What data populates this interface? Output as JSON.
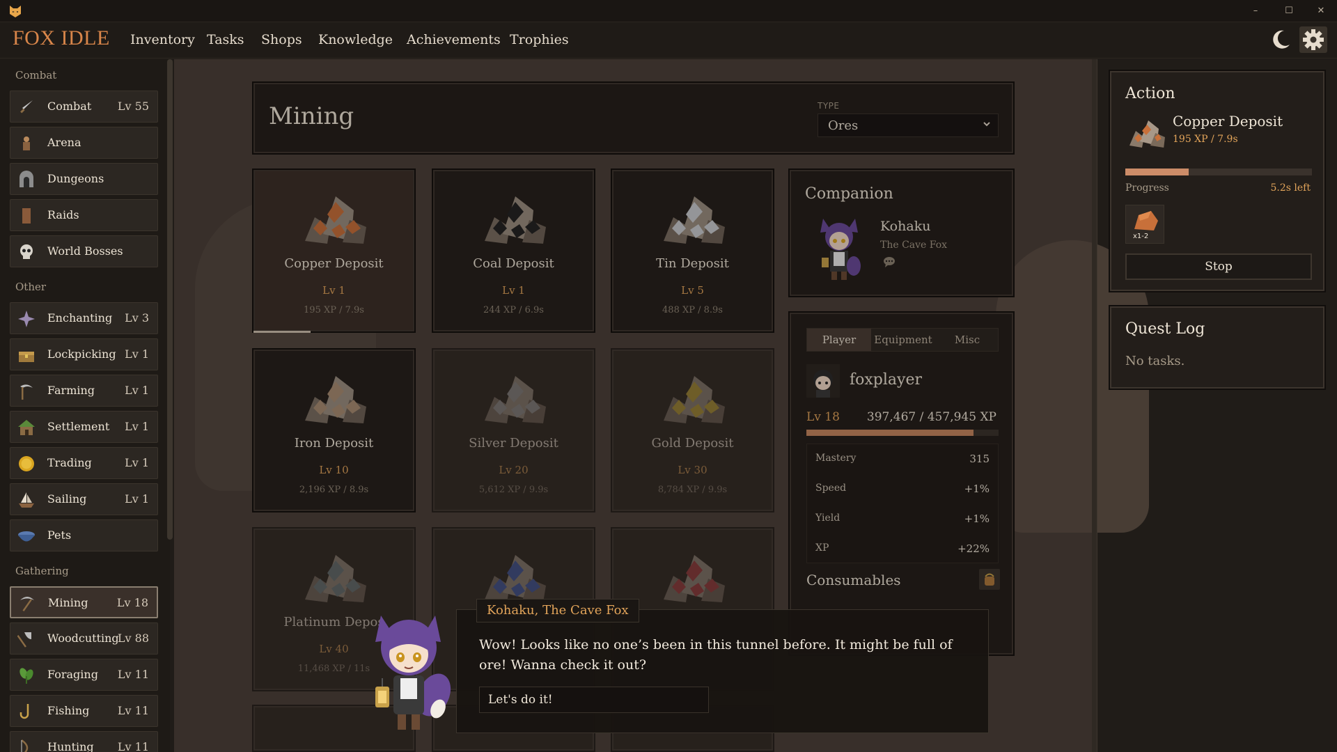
{
  "app": {
    "title": "FOX IDLE"
  },
  "nav": [
    "Inventory",
    "Tasks",
    "Shops",
    "Knowledge",
    "Achievements",
    "Trophies"
  ],
  "sidebar": {
    "sections": [
      {
        "title": "Combat",
        "items": [
          {
            "label": "Combat",
            "level": "Lv 55",
            "icon": "sword-icon"
          },
          {
            "label": "Arena",
            "level": "",
            "icon": "arena-icon"
          },
          {
            "label": "Dungeons",
            "level": "",
            "icon": "dungeon-icon"
          },
          {
            "label": "Raids",
            "level": "",
            "icon": "raid-banner-icon"
          },
          {
            "label": "World Bosses",
            "level": "",
            "icon": "skull-icon"
          }
        ]
      },
      {
        "title": "Other",
        "items": [
          {
            "label": "Enchanting",
            "level": "Lv 3",
            "icon": "enchant-icon"
          },
          {
            "label": "Lockpicking",
            "level": "Lv 1",
            "icon": "chest-icon"
          },
          {
            "label": "Farming",
            "level": "Lv 1",
            "icon": "scythe-icon"
          },
          {
            "label": "Settlement",
            "level": "Lv 1",
            "icon": "house-icon"
          },
          {
            "label": "Trading",
            "level": "Lv 1",
            "icon": "coin-icon"
          },
          {
            "label": "Sailing",
            "level": "Lv 1",
            "icon": "ship-icon"
          },
          {
            "label": "Pets",
            "level": "",
            "icon": "pet-bowl-icon"
          }
        ]
      },
      {
        "title": "Gathering",
        "items": [
          {
            "label": "Mining",
            "level": "Lv 18",
            "icon": "pickaxe-icon",
            "active": true
          },
          {
            "label": "Woodcutting",
            "level": "Lv 88",
            "icon": "axe-icon"
          },
          {
            "label": "Foraging",
            "level": "Lv 11",
            "icon": "herb-icon"
          },
          {
            "label": "Fishing",
            "level": "Lv 11",
            "icon": "hook-icon"
          },
          {
            "label": "Hunting",
            "level": "Lv 11",
            "icon": "bow-icon"
          }
        ]
      }
    ]
  },
  "mining": {
    "title": "Mining",
    "type_label": "TYPE",
    "type_value": "Ores",
    "tiles": [
      {
        "name": "Copper Deposit",
        "level": "Lv 1",
        "xp": "195 XP / 7.9s",
        "color": "#c8703a",
        "selected": true
      },
      {
        "name": "Coal Deposit",
        "level": "Lv 1",
        "xp": "244 XP / 6.9s",
        "color": "#222222"
      },
      {
        "name": "Tin Deposit",
        "level": "Lv 5",
        "xp": "488 XP / 8.9s",
        "color": "#c9ccd0"
      },
      {
        "name": "Iron Deposit",
        "level": "Lv 10",
        "xp": "2,196 XP / 8.9s",
        "color": "#a88d72"
      },
      {
        "name": "Silver Deposit",
        "level": "Lv 20",
        "xp": "5,612 XP / 9.9s",
        "color": "#9a9a9a",
        "dim": true
      },
      {
        "name": "Gold Deposit",
        "level": "Lv 30",
        "xp": "8,784 XP / 9.9s",
        "color": "#c4a534",
        "dim": true
      },
      {
        "name": "Platinum Depos",
        "level": "Lv 40",
        "xp": "11,468 XP / 11s",
        "color": "#6f8085",
        "dim": true
      },
      {
        "name": "",
        "level": "",
        "xp": "",
        "color": "#3e59b0",
        "dim": true
      },
      {
        "name": "",
        "level": "",
        "xp": "",
        "color": "#a8393d",
        "dim": true
      }
    ]
  },
  "companion": {
    "title": "Companion",
    "name": "Kohaku",
    "subtitle": "The Cave Fox"
  },
  "player": {
    "tabs": [
      "Player",
      "Equipment",
      "Misc"
    ],
    "name": "foxplayer",
    "level": "Lv 18",
    "xp": "397,467 / 457,945 XP",
    "xp_progress": 0.868,
    "stats": [
      {
        "k": "Mastery",
        "v": "315"
      },
      {
        "k": "Speed",
        "v": "+1%"
      },
      {
        "k": "Yield",
        "v": "+1%"
      },
      {
        "k": "XP",
        "v": "+22%"
      }
    ],
    "consumables": "Consumables"
  },
  "action": {
    "title": "Action",
    "name": "Copper Deposit",
    "xp": "195 XP / 7.9s",
    "progress": 0.34,
    "progress_label": "Progress",
    "time_left": "5.2s left",
    "drop_qty": "x1-2",
    "stop": "Stop"
  },
  "quest": {
    "title": "Quest Log",
    "empty": "No tasks."
  },
  "dialog": {
    "speaker": "Kohaku, The Cave Fox",
    "text": "Wow! Looks like no one’s been in this tunnel before. It might be full of ore! Wanna check it out?",
    "button": "Let's do it!"
  }
}
